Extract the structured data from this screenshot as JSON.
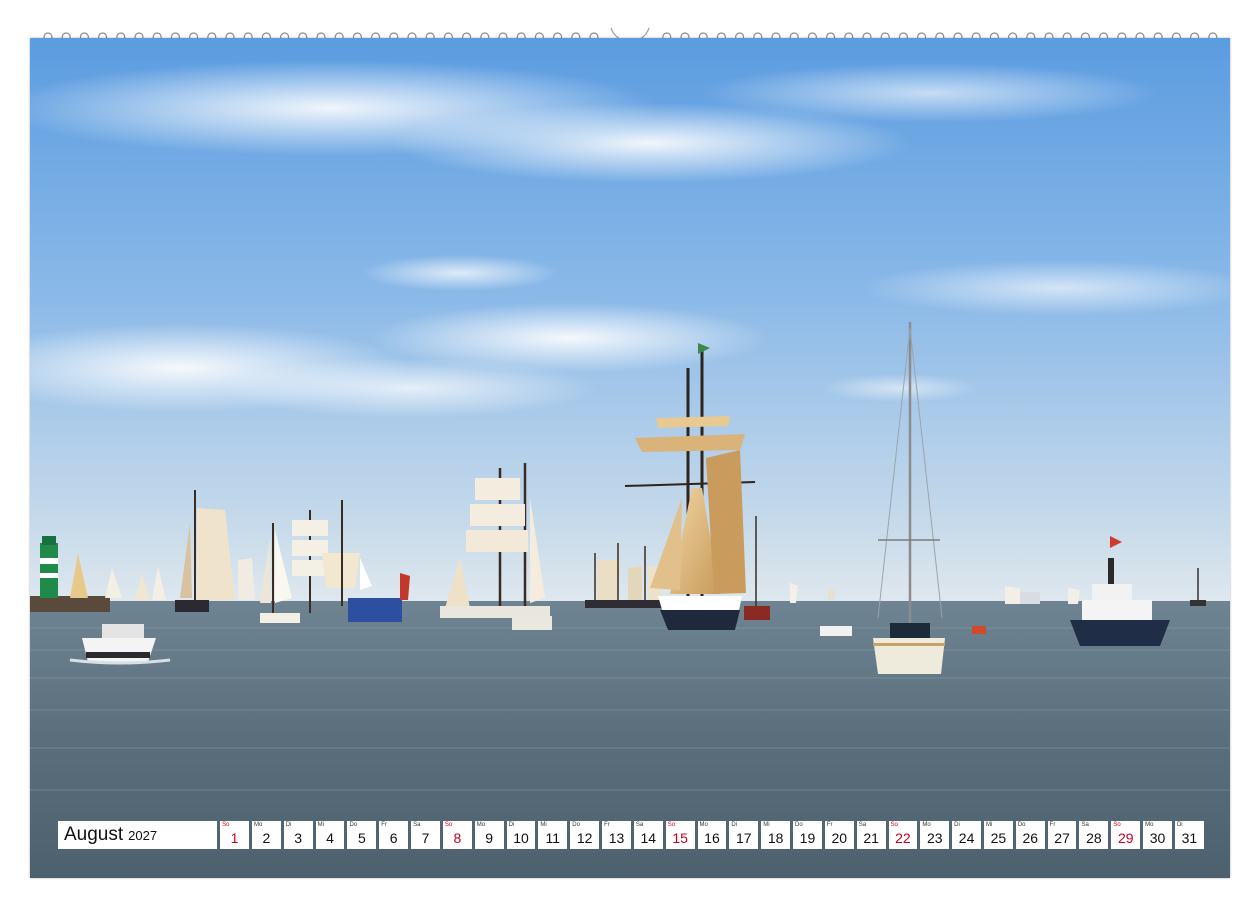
{
  "calendar": {
    "month": "August",
    "year": "2027",
    "days": [
      {
        "abbr": "So",
        "num": "1",
        "sunday": true
      },
      {
        "abbr": "Mo",
        "num": "2"
      },
      {
        "abbr": "Di",
        "num": "3"
      },
      {
        "abbr": "Mi",
        "num": "4"
      },
      {
        "abbr": "Do",
        "num": "5"
      },
      {
        "abbr": "Fr",
        "num": "6"
      },
      {
        "abbr": "Sa",
        "num": "7"
      },
      {
        "abbr": "So",
        "num": "8",
        "sunday": true
      },
      {
        "abbr": "Mo",
        "num": "9"
      },
      {
        "abbr": "Di",
        "num": "10"
      },
      {
        "abbr": "Mi",
        "num": "11"
      },
      {
        "abbr": "Do",
        "num": "12"
      },
      {
        "abbr": "Fr",
        "num": "13"
      },
      {
        "abbr": "Sa",
        "num": "14"
      },
      {
        "abbr": "So",
        "num": "15",
        "sunday": true
      },
      {
        "abbr": "Mo",
        "num": "16"
      },
      {
        "abbr": "Di",
        "num": "17"
      },
      {
        "abbr": "Mi",
        "num": "18"
      },
      {
        "abbr": "Do",
        "num": "19"
      },
      {
        "abbr": "Fr",
        "num": "20"
      },
      {
        "abbr": "Sa",
        "num": "21"
      },
      {
        "abbr": "So",
        "num": "22",
        "sunday": true
      },
      {
        "abbr": "Mo",
        "num": "23"
      },
      {
        "abbr": "Di",
        "num": "24"
      },
      {
        "abbr": "Mi",
        "num": "25"
      },
      {
        "abbr": "Do",
        "num": "26"
      },
      {
        "abbr": "Fr",
        "num": "27"
      },
      {
        "abbr": "Sa",
        "num": "28"
      },
      {
        "abbr": "So",
        "num": "29",
        "sunday": true
      },
      {
        "abbr": "Mo",
        "num": "30"
      },
      {
        "abbr": "Di",
        "num": "31"
      }
    ]
  },
  "colors": {
    "sunday": "#c8001e",
    "sky_top": "#5f9fe0",
    "sky_horizon": "#d9e6ee",
    "sea": "#556a78"
  },
  "icons": {
    "binding": "spiral-binding-rings",
    "hanger": "calendar-hanger-hole"
  }
}
